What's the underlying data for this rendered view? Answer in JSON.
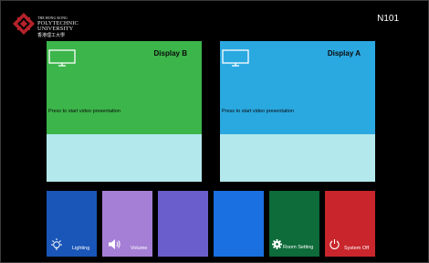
{
  "header": {
    "university_small": "THE HONG KONG",
    "university_name": "POLYTECHNIC UNIVERSITY",
    "university_chinese": "香港理工大學",
    "room": "N101"
  },
  "displays": [
    {
      "title": "Display B",
      "prompt": "Press to start video presentation",
      "color": "#3cb54a"
    },
    {
      "title": "Display A",
      "prompt": "Press to start video presentation",
      "color": "#2aa8e0"
    }
  ],
  "tiles": [
    {
      "label": "Lighting",
      "icon": "lightbulb-icon",
      "color": "#1a55b8"
    },
    {
      "label": "Volume",
      "icon": "speaker-icon",
      "color": "#a57fd6"
    },
    {
      "label": "",
      "icon": "",
      "color": "#6a5ecc"
    },
    {
      "label": "",
      "icon": "",
      "color": "#1a70e0"
    },
    {
      "label": "Room Setting",
      "icon": "gear-icon",
      "color": "#0e6b3a"
    },
    {
      "label": "System Off",
      "icon": "power-icon",
      "color": "#c8262c"
    }
  ],
  "colors": {
    "background": "#000000",
    "display_bottom": "#b3e8ec",
    "logo_red": "#b5222a"
  }
}
